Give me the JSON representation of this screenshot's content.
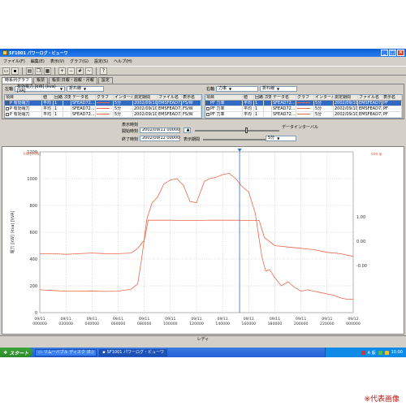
{
  "window": {
    "title": "SF1001 パワーログ・ビューワ",
    "minimize": "_",
    "maximize": "□",
    "close": "×"
  },
  "menu": [
    "ファイル(F)",
    "編集(E)",
    "表示(V)",
    "グラフ(G)",
    "設定(S)",
    "ヘルプ(H)"
  ],
  "toolbar_icons": [
    "open-icon",
    "save-icon",
    "print-icon",
    "copy-icon",
    "paste-icon",
    "zoom-in-icon",
    "zoom-out-icon",
    "grid-icon",
    "chart-icon",
    "settings-icon"
  ],
  "tabs": [
    "時系列グラフ",
    "帳票",
    "帳票:日報・週報・月報",
    "設定"
  ],
  "left_panel": {
    "axis_label": "左軸",
    "axis_value": "有効電力 [kW] (kva) [VA]",
    "mode_value": "折れ線",
    "columns": [
      "項目",
      "値",
      "回路",
      "次数",
      "データ名",
      "グラフ",
      "インターバル",
      "測定期間",
      "ファイル名",
      "表示名"
    ],
    "rows": [
      [
        "P 有効電力",
        "平均",
        "1",
        "",
        "SFEAD72...",
        "",
        "5分",
        "2002/09/10...",
        "EMSFEAD72C",
        "FS/W"
      ],
      [
        "P 有効電力",
        "平均",
        "1",
        "",
        "SFEAD72...",
        "",
        "5分",
        "2002/09/10...",
        "EMSFEAD72C",
        "FS/W"
      ],
      [
        "P 有効電力",
        "平均",
        "1",
        "",
        "SFEAD72...",
        "",
        "5分",
        "2002/09/10...",
        "EMSFEAD72C",
        "FS/W"
      ]
    ]
  },
  "right_panel": {
    "axis_label": "右軸",
    "axis_value": "力率",
    "mode_value": "折れ線",
    "columns": [
      "項目",
      "値",
      "回路",
      "次数",
      "データ名",
      "グラフ",
      "インターバル",
      "測定期間",
      "ファイル名",
      "表示名"
    ],
    "rows": [
      [
        "PF 力率",
        "平均",
        "1",
        "",
        "SFEAD72...",
        "",
        "5分",
        "2002/09/10...",
        "EMSFEAD72C",
        "PF"
      ],
      [
        "PF 力率",
        "平均",
        "1",
        "",
        "SFEAD72...",
        "",
        "5分",
        "2002/09/10...",
        "EMSFEAD72C",
        "PF"
      ],
      [
        "PF 力率",
        "平均",
        "1",
        "",
        "SFEAD72...",
        "",
        "5分",
        "2002/09/10...",
        "EMSFEAD72C",
        "PF"
      ]
    ]
  },
  "controls": {
    "display_time_label": "表示時刻",
    "start_label": "開始時刻",
    "start_value": "2002/09/11 000000",
    "end_label": "終了時刻",
    "end_value": "2002/09/12 000000",
    "period_label": "表示期間",
    "interval_label": "データインターバル",
    "interval_value": "5分",
    "cursor_position": 0.62
  },
  "chart_data": {
    "type": "line",
    "left_axis_label": "電力 [kW] (kva) [kVA]",
    "left_unit_label": "kW[kVA]",
    "right_unit_label": "cos φ",
    "ylim_left": [
      0,
      1200
    ],
    "ylim_right": [
      -2,
      2
    ],
    "left_ticks": [
      "0",
      "200",
      "400",
      "600",
      "800",
      "1000",
      "1200"
    ],
    "right_ticks": [
      "-1.00",
      "-0.00",
      "0.00",
      "1.00"
    ],
    "x_ticks": [
      [
        "09/11",
        "000000"
      ],
      [
        "09/11",
        "020000"
      ],
      [
        "09/11",
        "040000"
      ],
      [
        "09/11",
        "060000"
      ],
      [
        "09/11",
        "080000"
      ],
      [
        "09/11",
        "100000"
      ],
      [
        "09/11",
        "120000"
      ],
      [
        "09/11",
        "140000"
      ],
      [
        "09/11",
        "160000"
      ],
      [
        "09/11",
        "180000"
      ],
      [
        "09/11",
        "200000"
      ],
      [
        "09/11",
        "220000"
      ],
      [
        "09/12",
        "000000"
      ]
    ],
    "xlim_hours": [
      0,
      24
    ],
    "cursor_hour": 15.3,
    "grid": true,
    "series": [
      {
        "name": "",
        "color": "#e8684a",
        "x": [
          0,
          1,
          2,
          3,
          4,
          5,
          6,
          7,
          7.5,
          7.8,
          8.2,
          8.6,
          9,
          9.5,
          10,
          10.5,
          11,
          11.5,
          12,
          12.3,
          12.6,
          13,
          13.5,
          14,
          14.5,
          15,
          15.5,
          16,
          16.5,
          17,
          17.3,
          17.6,
          18,
          18.5,
          19,
          19.5,
          20,
          20.5,
          21,
          21.5,
          22,
          22.5,
          23,
          23.5,
          24
        ],
        "y": [
          170,
          165,
          160,
          160,
          162,
          158,
          160,
          175,
          215,
          400,
          700,
          820,
          860,
          960,
          990,
          1000,
          950,
          830,
          820,
          900,
          980,
          1000,
          1010,
          1030,
          1040,
          1000,
          940,
          900,
          740,
          420,
          310,
          320,
          260,
          200,
          230,
          190,
          160,
          170,
          160,
          150,
          140,
          130,
          110,
          100,
          100
        ]
      },
      {
        "name": "",
        "color": "#e8684a",
        "x": [
          0,
          1,
          2,
          3,
          4,
          5,
          6,
          7,
          7.5,
          8,
          8.3,
          9,
          10,
          11,
          12,
          13,
          14,
          15,
          16,
          16.8,
          17.2,
          17.6,
          18,
          19,
          20,
          21,
          22,
          23,
          24
        ],
        "y": [
          440,
          440,
          435,
          440,
          445,
          440,
          440,
          445,
          480,
          540,
          690,
          690,
          690,
          688,
          688,
          690,
          690,
          690,
          688,
          688,
          560,
          530,
          500,
          490,
          480,
          470,
          450,
          440,
          420
        ]
      }
    ]
  },
  "status_text": "レディ",
  "taskbar": {
    "start_label": "スタート",
    "tasks": [
      "リムーバブル ディスク (E:)",
      "SF1001 パワーログ・ビューワ"
    ],
    "tray_text": "A 般",
    "clock": "10:00"
  },
  "caption": "※代表画像"
}
